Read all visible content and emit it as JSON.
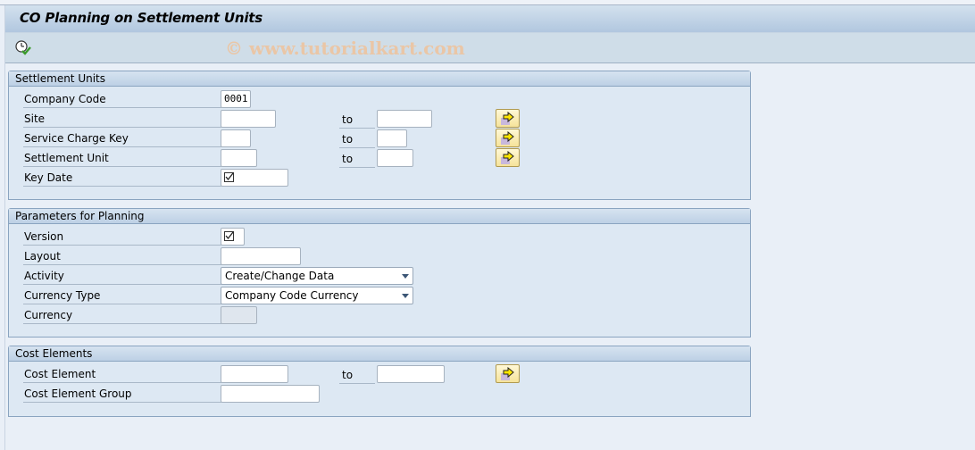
{
  "window": {
    "title": "CO Planning on Settlement Units",
    "watermark": "© www.tutorialkart.com"
  },
  "toolbar": {
    "execute_icon": "execute-clock-check-icon"
  },
  "groups": {
    "settlement_units": {
      "title": "Settlement Units",
      "fields": {
        "company_code": {
          "label": "Company Code",
          "value": "0001"
        },
        "site": {
          "label": "Site",
          "from": "",
          "to_label": "to",
          "to": ""
        },
        "service_charge_key": {
          "label": "Service Charge Key",
          "from": "",
          "to_label": "to",
          "to": ""
        },
        "settlement_unit": {
          "label": "Settlement Unit",
          "from": "",
          "to_label": "to",
          "to": ""
        },
        "key_date": {
          "label": "Key Date",
          "value": "",
          "required_icon": "required-check-icon"
        }
      }
    },
    "parameters": {
      "title": "Parameters for Planning",
      "fields": {
        "version": {
          "label": "Version",
          "value": "",
          "required_icon": "required-check-icon"
        },
        "layout": {
          "label": "Layout",
          "value": ""
        },
        "activity": {
          "label": "Activity",
          "value": "Create/Change Data"
        },
        "currency_type": {
          "label": "Currency Type",
          "value": "Company Code Currency"
        },
        "currency": {
          "label": "Currency",
          "value": ""
        }
      }
    },
    "cost_elements": {
      "title": "Cost Elements",
      "fields": {
        "cost_element": {
          "label": "Cost Element",
          "from": "",
          "to_label": "to",
          "to": ""
        },
        "cost_element_group": {
          "label": "Cost Element Group",
          "value": ""
        }
      }
    }
  },
  "icons": {
    "multiple_selection": "multiple-selection-arrow-icon"
  }
}
